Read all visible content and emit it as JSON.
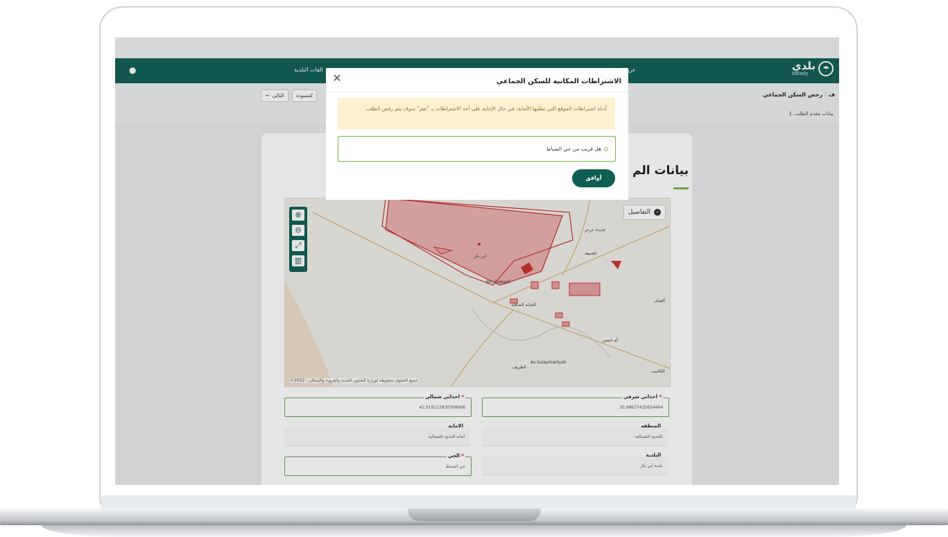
{
  "colors": {
    "brand_green": "#0e5e53",
    "accent_green": "#7cb342",
    "warning_bg": "#fcf0d0",
    "required_star": "#d0021b"
  },
  "brand": {
    "name": "بلدي",
    "sub": "balady",
    "logo_icon": "balady-logo-icon"
  },
  "nav": {
    "links": [
      "عن بلـ",
      "الفات البلدية"
    ],
    "globe_icon": "globe-icon"
  },
  "breadcrumb": {
    "current": "رخص السكن الجماعي",
    "next": "ف"
  },
  "step": {
    "label": "1. بيانات مقدم الطلب"
  },
  "toolbar": {
    "next_label": "التالي",
    "draft_label": "كمسودة"
  },
  "section": {
    "title": "بيانات الم"
  },
  "map": {
    "details_label": "التفاصيل",
    "copyright": "©جميع الحقوق محفوظة لوزارة الشئون البلدية والقروية والإسكان - 2022",
    "place_labels": [
      "جديدة عرعر",
      "الحنيفة",
      "ابن بكر",
      "Ibn Suwayd",
      "As Sulaymaniyah",
      "الطريف",
      "الكاسب",
      "أم خنيص",
      "العيبان",
      "الحيانه الساقية"
    ],
    "tools": [
      "zoom-in-icon",
      "zoom-out-icon",
      "fullscreen-icon",
      "trash-icon"
    ]
  },
  "fields": {
    "east": {
      "label": "احداثي شرقي",
      "value": "30.98637432654464",
      "required": true
    },
    "north": {
      "label": "احداثي شمالي",
      "value": "41.019112830768066",
      "required": true
    },
    "region": {
      "label": "المنطقه",
      "value": "الحدود الشمالية"
    },
    "amana": {
      "label": "الامانة",
      "value": "أمانة الحدود الشمالية"
    },
    "municipality": {
      "label": "البلدية",
      "value": "بلدية ابن بكر"
    },
    "district": {
      "label": "الحي",
      "value": "حي الضباط",
      "required": true
    }
  },
  "modal": {
    "title": "الاشتراطات المكانية للسكن الجماعي",
    "warning": "أدناه اشتراطات الموقع التي تطلبها الأمانة، في حال الإجابة على أحد الاشتراطات بـ \"نعم\" سوف يتم رفض الطلب",
    "question": "هل قريب من حي الضباط",
    "agree_label": "أوافق"
  }
}
